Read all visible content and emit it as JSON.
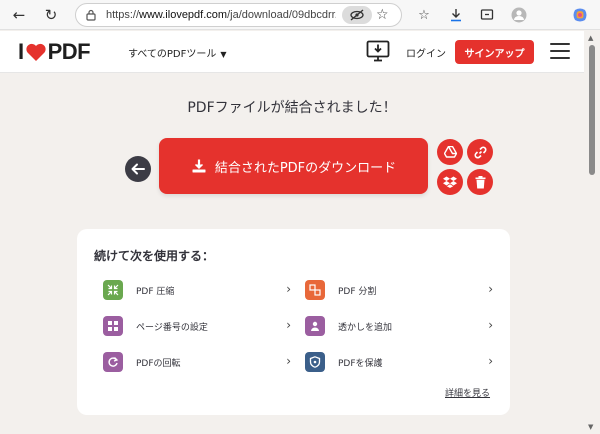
{
  "browser": {
    "url_scheme": "https://",
    "url_host": "www.ilovepdf.com",
    "url_path": "/ja/download/09dbcdrr..."
  },
  "header": {
    "logo_left": "I",
    "logo_right": "PDF",
    "tools_menu_label": "すべてのPDFツール",
    "login_label": "ログイン",
    "signup_label": "サインアップ"
  },
  "main": {
    "success_message": "PDFファイルが結合されました！",
    "download_label": "結合されたPDFのダウンロード"
  },
  "continue_card": {
    "title": "続けて次を使用する：",
    "tools": [
      {
        "label": "PDF 圧縮",
        "icon": "compress-icon",
        "color": "#6aa84f"
      },
      {
        "label": "PDF 分割",
        "icon": "split-icon",
        "color": "#e8683a"
      },
      {
        "label": "ページ番号の設定",
        "icon": "page-numbers-icon",
        "color": "#9b5ea0"
      },
      {
        "label": "透かしを追加",
        "icon": "watermark-icon",
        "color": "#9b5ea0"
      },
      {
        "label": "PDFの回転",
        "icon": "rotate-icon",
        "color": "#9b5ea0"
      },
      {
        "label": "PDFを保護",
        "icon": "protect-icon",
        "color": "#3b5f8a"
      }
    ],
    "more_link": "詳細を見る"
  },
  "colors": {
    "brand_red": "#e5322d",
    "dark_button": "#3c3c45",
    "page_bg": "#f3f0ed"
  }
}
